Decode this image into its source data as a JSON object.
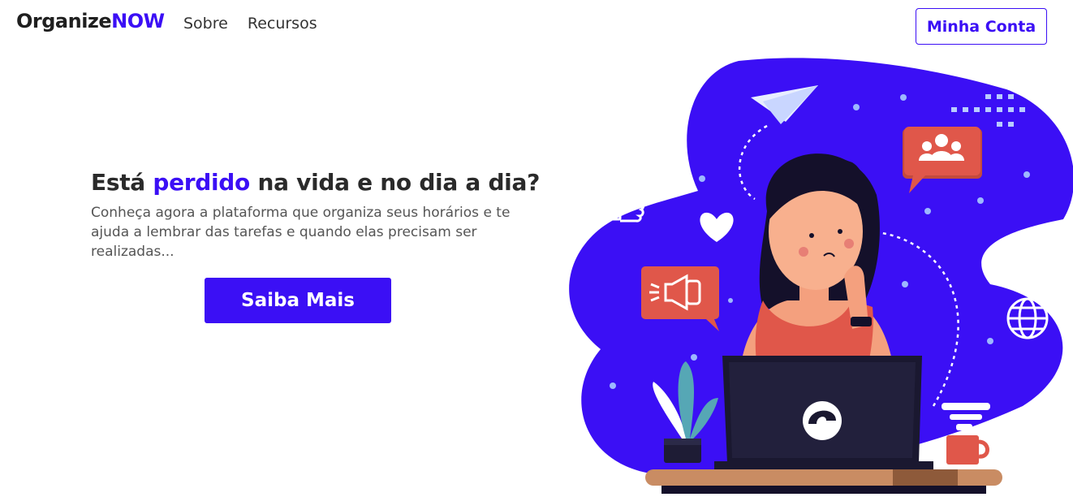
{
  "brand": {
    "part1": "Organize",
    "part2": "NOW"
  },
  "nav": {
    "items": [
      {
        "label": "Sobre"
      },
      {
        "label": "Recursos"
      }
    ]
  },
  "account_button": {
    "label": "Minha Conta"
  },
  "hero": {
    "title_before": "Está ",
    "title_highlight": "perdido",
    "title_after": " na vida e no dia a dia?",
    "description": "Conheça agora a plataforma que organiza seus horários e te ajuda a lembrar das tarefas e quando elas precisam ser realizadas...",
    "cta_label": "Saiba Mais"
  },
  "colors": {
    "accent": "#3b0ff5",
    "illustration_bg": "#3b0ff5",
    "badge_red": "#e0574a"
  },
  "illustration": {
    "icons": [
      "paper-plane-icon",
      "people-icon",
      "thumbs-up-icon",
      "heart-icon",
      "megaphone-icon",
      "globe-icon"
    ]
  }
}
